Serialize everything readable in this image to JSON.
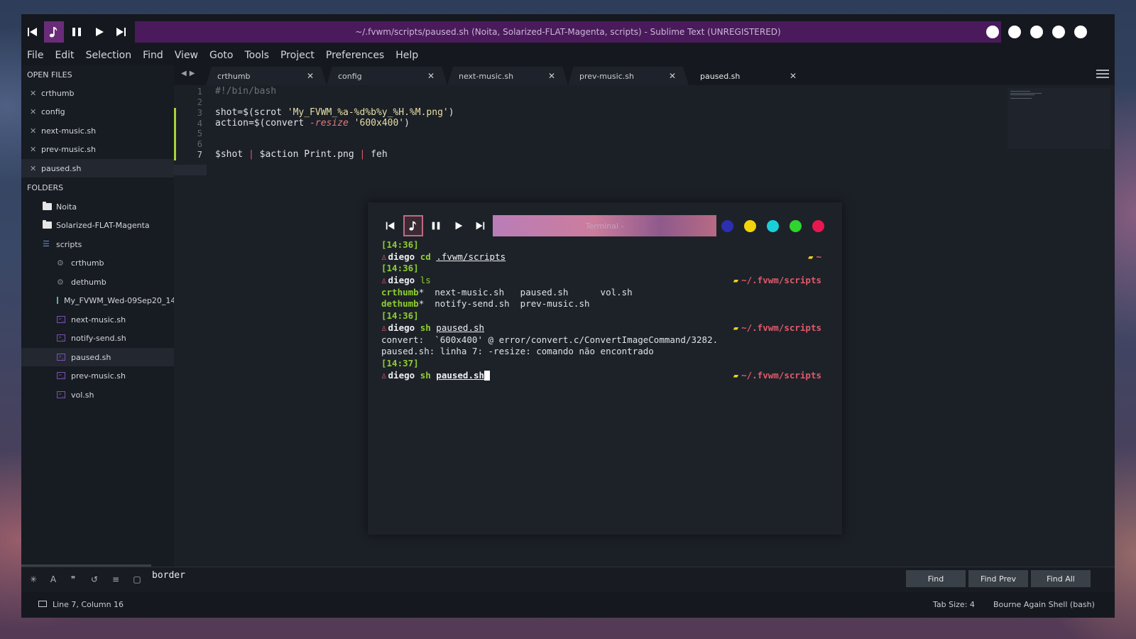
{
  "titlebar": {
    "title": "~/.fvwm/scripts/paused.sh (Noita, Solarized-FLAT-Magenta, scripts) - Sublime Text (UNREGISTERED)"
  },
  "menu": [
    "File",
    "Edit",
    "Selection",
    "Find",
    "View",
    "Goto",
    "Tools",
    "Project",
    "Preferences",
    "Help"
  ],
  "sidebar": {
    "open_files_heading": "OPEN FILES",
    "open_files": [
      "crthumb",
      "config",
      "next-music.sh",
      "prev-music.sh",
      "paused.sh"
    ],
    "folders_heading": "FOLDERS",
    "folders": [
      "Noita",
      "Solarized-FLAT-Magenta",
      "scripts"
    ],
    "files": [
      "crthumb",
      "dethumb",
      "My_FVWM_Wed-09Sep20_14.",
      "next-music.sh",
      "notify-send.sh",
      "paused.sh",
      "prev-music.sh",
      "vol.sh"
    ]
  },
  "tabs": [
    "crthumb",
    "config",
    "next-music.sh",
    "prev-music.sh",
    "paused.sh"
  ],
  "editor": {
    "line_numbers": [
      "1",
      "2",
      "3",
      "4",
      "5",
      "6",
      "7"
    ],
    "shebang": "#!/bin/bash",
    "l3_a": "shot=$(scrot ",
    "l3_str": "'My_FVWM_%a-%d%b%y_%H.%M.png'",
    "l3_b": ")",
    "l4_a": "action=$(convert ",
    "l4_flag": "-resize",
    "l4_str": " '600x400'",
    "l4_b": ")",
    "l7_a": "$shot ",
    "l7_pipe1": "|",
    "l7_b": " $action Print.png ",
    "l7_pipe2": "|",
    "l7_c": " feh"
  },
  "terminal": {
    "title": "Terminal -",
    "dot_colors": [
      "#2c2fb0",
      "#f2d40a",
      "#1ad0d8",
      "#2fd42c",
      "#e8184e"
    ],
    "t1": "[14:36]",
    "user": "diego",
    "cmd_cd": "cd",
    "arg_cd": ".fvwm/scripts",
    "path_home": "~",
    "t2": "[14:36]",
    "cmd_ls": "ls",
    "path_scripts": "~/.fvwm/scripts",
    "ls_row1_exec": "crthumb",
    "ls_row1_rest": "*  next-music.sh   paused.sh      vol.sh",
    "ls_row2_exec": "dethumb",
    "ls_row2_rest": "*  notify-send.sh  prev-music.sh",
    "t3": "[14:36]",
    "cmd_sh": "sh",
    "arg_sh": "paused.sh",
    "err1": "convert:  `600x400' @ error/convert.c/ConvertImageCommand/3282.",
    "err2": "paused.sh: linha 7: -resize: comando não encontrado",
    "t4": "[14:37]"
  },
  "findbar": {
    "input_value": "border",
    "find": "Find",
    "find_prev": "Find Prev",
    "find_all": "Find All"
  },
  "statusbar": {
    "position": "Line 7, Column 16",
    "tab_size": "Tab Size: 4",
    "syntax": "Bourne Again Shell (bash)"
  }
}
